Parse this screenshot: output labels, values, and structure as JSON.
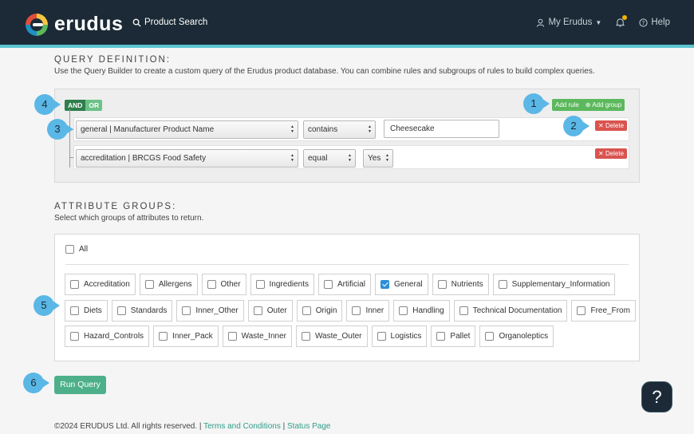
{
  "header": {
    "logo_text": "erudus",
    "search_label": "Product Search",
    "my_erudus_label": "My Erudus",
    "help_label": "Help"
  },
  "query": {
    "title": "QUERY DEFINITION:",
    "description": "Use the Query Builder to create a custom query of the Erudus product database. You can combine rules and subgroups of rules to build complex queries.",
    "and_label": "AND",
    "or_label": "OR",
    "add_rule_label": "Add rule",
    "add_group_label": "Add group",
    "delete_label": "Delete",
    "rules": [
      {
        "field": "general | Manufacturer Product Name",
        "operator": "contains",
        "value": "Cheesecake"
      },
      {
        "field": "accreditation | BRCGS Food Safety",
        "operator": "equal",
        "value": "Yes"
      }
    ]
  },
  "attributes": {
    "title": "ATTRIBUTE GROUPS:",
    "description": "Select which groups of attributes to return.",
    "all_label": "All",
    "rows": [
      [
        {
          "label": "Accreditation",
          "checked": false
        },
        {
          "label": "Allergens",
          "checked": false
        },
        {
          "label": "Other",
          "checked": false
        },
        {
          "label": "Ingredients",
          "checked": false
        },
        {
          "label": "Artificial",
          "checked": false
        },
        {
          "label": "General",
          "checked": true
        },
        {
          "label": "Nutrients",
          "checked": false
        },
        {
          "label": "Supplementary_Information",
          "checked": false
        }
      ],
      [
        {
          "label": "Diets",
          "checked": false
        },
        {
          "label": "Standards",
          "checked": false
        },
        {
          "label": "Inner_Other",
          "checked": false
        },
        {
          "label": "Outer",
          "checked": false
        },
        {
          "label": "Origin",
          "checked": false
        },
        {
          "label": "Inner",
          "checked": false
        },
        {
          "label": "Handling",
          "checked": false
        },
        {
          "label": "Technical Documentation",
          "checked": false
        },
        {
          "label": "Free_From",
          "checked": false
        }
      ],
      [
        {
          "label": "Hazard_Controls",
          "checked": false
        },
        {
          "label": "Inner_Pack",
          "checked": false
        },
        {
          "label": "Waste_Inner",
          "checked": false
        },
        {
          "label": "Waste_Outer",
          "checked": false
        },
        {
          "label": "Logistics",
          "checked": false
        },
        {
          "label": "Pallet",
          "checked": false
        },
        {
          "label": "Organoleptics",
          "checked": false
        }
      ]
    ]
  },
  "run_query_label": "Run Query",
  "footer": {
    "copyright": "©2024 ERUDUS Ltd. All rights reserved. |",
    "terms_label": "Terms and Conditions",
    "separator": "|",
    "status_label": "Status Page"
  },
  "help_fab_label": "?",
  "callouts": [
    "1",
    "2",
    "3",
    "4",
    "5",
    "6"
  ],
  "colors": {
    "header_bg": "#1b2a36",
    "accent": "#5bc4cf",
    "and_button": "#2f7e4d",
    "add_button": "#5cb85c",
    "delete_button": "#d9534f",
    "run_button": "#4db08a",
    "checkbox_checked": "#2c8ed6",
    "callout": "#5ab7e6"
  }
}
